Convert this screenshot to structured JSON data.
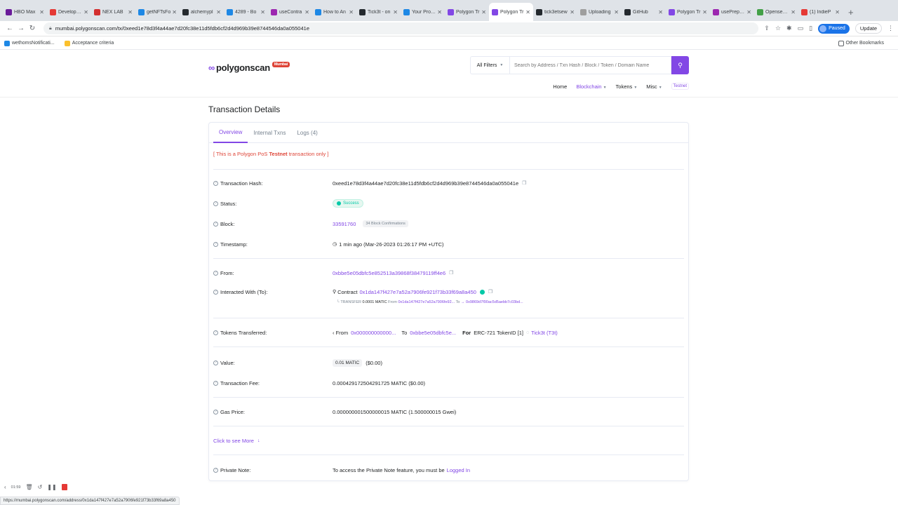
{
  "browser": {
    "tabs": [
      {
        "label": "HBO Max",
        "color": "#6a1b9a"
      },
      {
        "label": "Developm...",
        "color": "#e53935"
      },
      {
        "label": "NEX LAB",
        "color": "#d32f2f"
      },
      {
        "label": "getNFTsFo",
        "color": "#1e88e5"
      },
      {
        "label": "alchemypl",
        "color": "#24292e"
      },
      {
        "label": "4289 - Bo",
        "color": "#1e88e5"
      },
      {
        "label": "useContra",
        "color": "#9c27b0"
      },
      {
        "label": "How to An",
        "color": "#1e88e5"
      },
      {
        "label": "Tick3t - on",
        "color": "#24292e"
      },
      {
        "label": "Your Profile",
        "color": "#1e88e5"
      },
      {
        "label": "Polygon Tr",
        "color": "#8247e5"
      },
      {
        "label": "Polygon Tr",
        "color": "#8247e5",
        "active": true
      },
      {
        "label": "tick3etsew",
        "color": "#24292e"
      },
      {
        "label": "Uploading",
        "color": "#9e9e9e"
      },
      {
        "label": "GitHub",
        "color": "#24292e"
      },
      {
        "label": "Polygon Tr",
        "color": "#8247e5"
      },
      {
        "label": "usePrepare",
        "color": "#9c27b0"
      },
      {
        "label": "Opensea T",
        "color": "#43a047"
      },
      {
        "label": "(1) IndieP",
        "color": "#e53935"
      }
    ],
    "tab_close": "✕",
    "new_tab": "+",
    "url": "mumbai.polygonscan.com/tx/0xeed1e78d3f4a44ae7d20fc38e11d5fdb6cf2d4d969b39e8744546da0a055041e",
    "paused_label": "Paused",
    "update_label": "Update",
    "bookmarks": [
      {
        "label": "wethomsNotificati...",
        "color": "#1e88e5"
      },
      {
        "label": "Acceptance criteria",
        "color": "#fbc02d"
      }
    ],
    "other_bookmarks": "Other Bookmarks",
    "status_url": "https://mumbai.polygonscan.com/address/0x1da147f427e7a52a7906fe921f73b33f69a8a450"
  },
  "site": {
    "logo_text": "polygonscan",
    "logo_badge": "Mumbai",
    "filter_label": "All Filters",
    "search_placeholder": "Search by Address / Txn Hash / Block / Token / Domain Name",
    "nav": {
      "home": "Home",
      "blockchain": "Blockchain",
      "tokens": "Tokens",
      "misc": "Misc",
      "testnet": "Testnet"
    }
  },
  "page": {
    "title": "Transaction Details",
    "tabs": {
      "overview": "Overview",
      "internal": "Internal Txns",
      "logs": "Logs (4)"
    },
    "notice_pre": "[ This is a Polygon PoS ",
    "notice_bold": "Testnet",
    "notice_post": " transaction only ]",
    "labels": {
      "hash": "Transaction Hash:",
      "status": "Status:",
      "block": "Block:",
      "timestamp": "Timestamp:",
      "from": "From:",
      "interacted": "Interacted With (To):",
      "tokens": "Tokens Transferred:",
      "value": "Value:",
      "fee": "Transaction Fee:",
      "gas": "Gas Price:",
      "note": "Private Note:"
    },
    "hash": "0xeed1e78d3f4a44ae7d20fc38e11d5fdb6cf2d4d969b39e8744546da0a055041e",
    "status": "Success",
    "block": "33591760",
    "confirmations": "34 Block Confirmations",
    "timestamp": "1 min ago (Mar-26-2023 01:26:17 PM +UTC)",
    "from": "0xbbe5e05dbfc5e852513a39868f38479119ff4e6",
    "contract_prefix": "Contract",
    "contract": "0x1da147f427e7a52a7906fe921f73b33f69a8a450",
    "transfer_label": "└ TRANSFER",
    "transfer_amount": "0.0001 MATIC",
    "transfer_from_label": "From",
    "transfer_from": "0x1da147f427e7a52a7906fe92...",
    "transfer_to_label": "To",
    "transfer_to": "→ 0x9869d7f90ac5d5aebb7c03bd...",
    "tokens_from_label": "‹ From",
    "tokens_from": "0x000000000000...",
    "tokens_to_label": "To",
    "tokens_to": "0xbbe5e05dbfc5e...",
    "tokens_for": "For",
    "tokens_erc": "ERC-721 TokenID [1]",
    "tokens_name": "Tick3t (T3t)",
    "value_badge": "0.01 MATIC",
    "value_usd": "($0.00)",
    "fee": "0.000429172504291725 MATIC ($0.00)",
    "gas": "0.000000001500000015 MATIC (1.500000015 Gwei)",
    "see_more": "Click to see More",
    "note_text": "To access the Private Note feature, you must be",
    "note_link": "Logged In"
  },
  "recorder": {
    "time": "01:59"
  }
}
